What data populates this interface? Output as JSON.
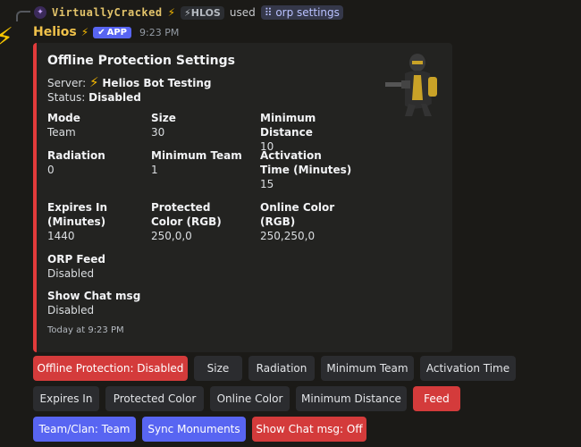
{
  "reply": {
    "user": "VirtuallyCracked",
    "tag": "⚡HLOS",
    "used_text": "used",
    "command": "orp settings"
  },
  "message": {
    "bot_name": "Helios",
    "app_badge": "APP",
    "time": "9:23 PM"
  },
  "embed": {
    "title": "Offline Protection Settings",
    "server_label": "Server:",
    "server_name": "Helios Bot Testing",
    "status_label": "Status:",
    "status_value": "Disabled",
    "accent_color": "#e23b3b",
    "fields": {
      "mode": {
        "name": "Mode",
        "value": "Team"
      },
      "size": {
        "name": "Size",
        "value": "30"
      },
      "min_distance": {
        "name": "Minimum Distance",
        "value": "10"
      },
      "radiation": {
        "name": "Radiation",
        "value": "0"
      },
      "min_team": {
        "name": "Minimum Team",
        "value": "1"
      },
      "activation_time": {
        "name": "Activation Time (Minutes)",
        "value": "15"
      },
      "expires_in": {
        "name": "Expires In (Minutes)",
        "value": "1440"
      },
      "protected_color": {
        "name": "Protected Color (RGB)",
        "value": "250,0,0"
      },
      "online_color": {
        "name": "Online Color (RGB)",
        "value": "250,250,0"
      },
      "orp_feed": {
        "name": "ORP Feed",
        "value": "Disabled"
      },
      "show_chat": {
        "name": "Show Chat msg",
        "value": "Disabled"
      }
    },
    "footer": "Today at 9:23 PM"
  },
  "buttons": {
    "offline_protection": "Offline Protection: Disabled",
    "size": "Size",
    "radiation": "Radiation",
    "minimum_team": "Minimum Team",
    "activation_time": "Activation Time",
    "expires_in": "Expires In",
    "protected_color": "Protected Color",
    "online_color": "Online Color",
    "minimum_distance": "Minimum Distance",
    "feed": "Feed",
    "team_clan": "Team/Clan: Team",
    "sync_monuments": "Sync Monuments",
    "show_chat": "Show Chat msg: Off"
  },
  "colors": {
    "danger": "#d43b3b",
    "secondary": "#2b2c2f",
    "primary": "#5865f2",
    "background": "#1b1a17"
  }
}
